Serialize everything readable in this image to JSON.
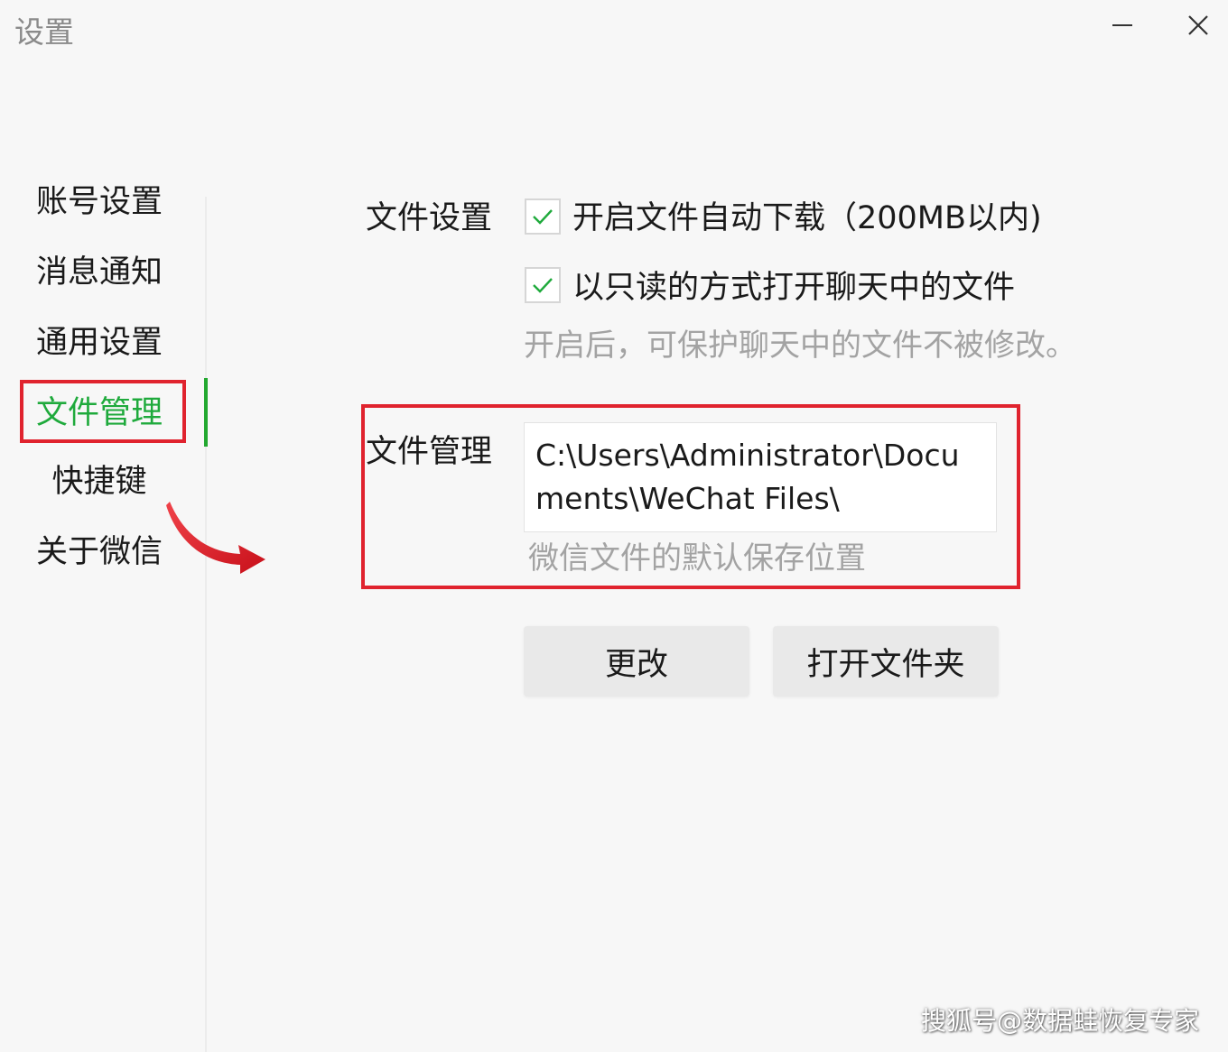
{
  "window": {
    "title": "设置",
    "minimize_icon": "minimize-icon",
    "close_icon": "close-icon"
  },
  "sidebar": {
    "items": [
      {
        "label": "账号设置"
      },
      {
        "label": "消息通知"
      },
      {
        "label": "通用设置"
      },
      {
        "label": "文件管理",
        "active": true
      },
      {
        "label": "快捷键"
      },
      {
        "label": "关于微信"
      }
    ],
    "active_color": "#1faa3c"
  },
  "file_settings": {
    "label": "文件设置",
    "auto_download": {
      "label": "开启文件自动下载（200MB以内)",
      "checked": true
    },
    "read_only": {
      "label": "以只读的方式打开聊天中的文件",
      "checked": true
    },
    "read_only_hint": "开启后，可保护聊天中的文件不被修改。"
  },
  "file_management": {
    "label": "文件管理",
    "path": "C:\\Users\\Administrator\\Documents\\WeChat Files\\",
    "hint": "微信文件的默认保存位置",
    "change_button": "更改",
    "open_folder_button": "打开文件夹"
  },
  "annotation": {
    "highlight_color": "#e0232e",
    "arrow_icon": "red-curved-arrow-icon"
  },
  "watermark": "搜狐号@数据蛙恢复专家"
}
